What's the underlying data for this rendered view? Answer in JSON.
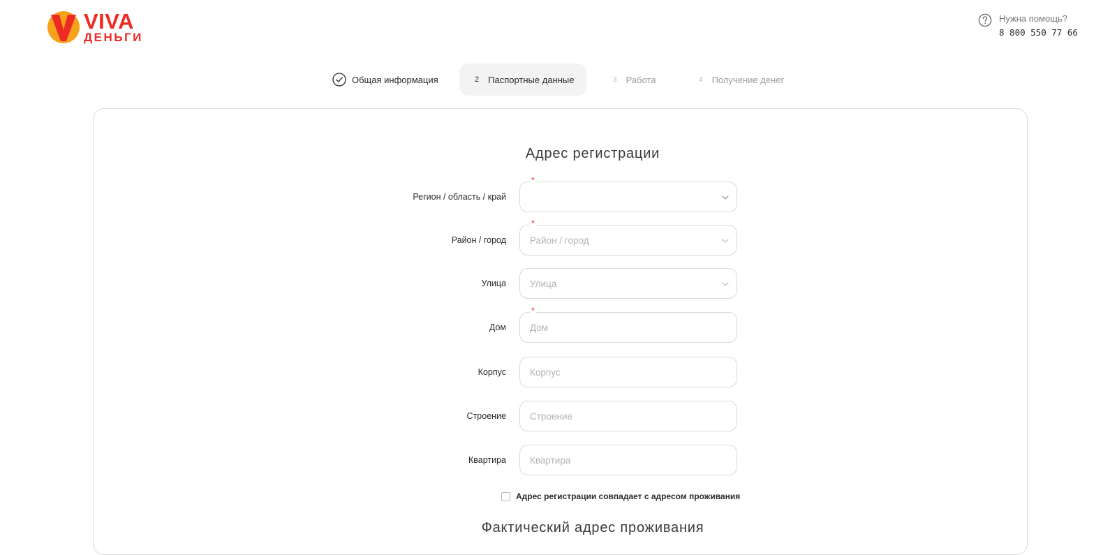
{
  "header": {
    "logo": {
      "line1": "VIVA",
      "line2": "ДЕНЬГИ"
    },
    "help": {
      "title": "Нужна помощь?",
      "phone": "8 800 550 77 66",
      "icon": "question-circle-icon"
    }
  },
  "stepper": {
    "steps": [
      {
        "label": "Общая информация",
        "number": "",
        "state": "completed",
        "icon": "check-circle-icon"
      },
      {
        "label": "Паспортные данные",
        "number": "2",
        "state": "active"
      },
      {
        "label": "Работа",
        "number": "3",
        "state": "upcoming"
      },
      {
        "label": "Получение денег",
        "number": "4",
        "state": "upcoming"
      }
    ]
  },
  "registration": {
    "title": "Адрес регистрации",
    "fields": [
      {
        "label": "Регион / область / край",
        "placeholder": "",
        "value": "",
        "required": true,
        "type": "select"
      },
      {
        "label": "Район / город",
        "placeholder": "Район / город",
        "value": "",
        "required": true,
        "type": "select"
      },
      {
        "label": "Улица",
        "placeholder": "Улица",
        "value": "",
        "required": false,
        "type": "select"
      },
      {
        "label": "Дом",
        "placeholder": "Дом",
        "value": "",
        "required": true,
        "type": "text"
      },
      {
        "label": "Корпус",
        "placeholder": "Корпус",
        "value": "",
        "required": false,
        "type": "text"
      },
      {
        "label": "Строение",
        "placeholder": "Строение",
        "value": "",
        "required": false,
        "type": "text"
      },
      {
        "label": "Квартира",
        "placeholder": "Квартира",
        "value": "",
        "required": false,
        "type": "text"
      }
    ],
    "required_mark": "*",
    "same_address_checkbox": {
      "label": "Адрес регистрации совпадает с адресом проживания",
      "checked": false
    }
  },
  "actual": {
    "title": "Фактический адрес проживания"
  },
  "colors": {
    "brand_red": "#ee2a24",
    "brand_orange": "#f7a21b",
    "border": "#d9d9d9",
    "active_step_bg": "#f3f3f3"
  }
}
